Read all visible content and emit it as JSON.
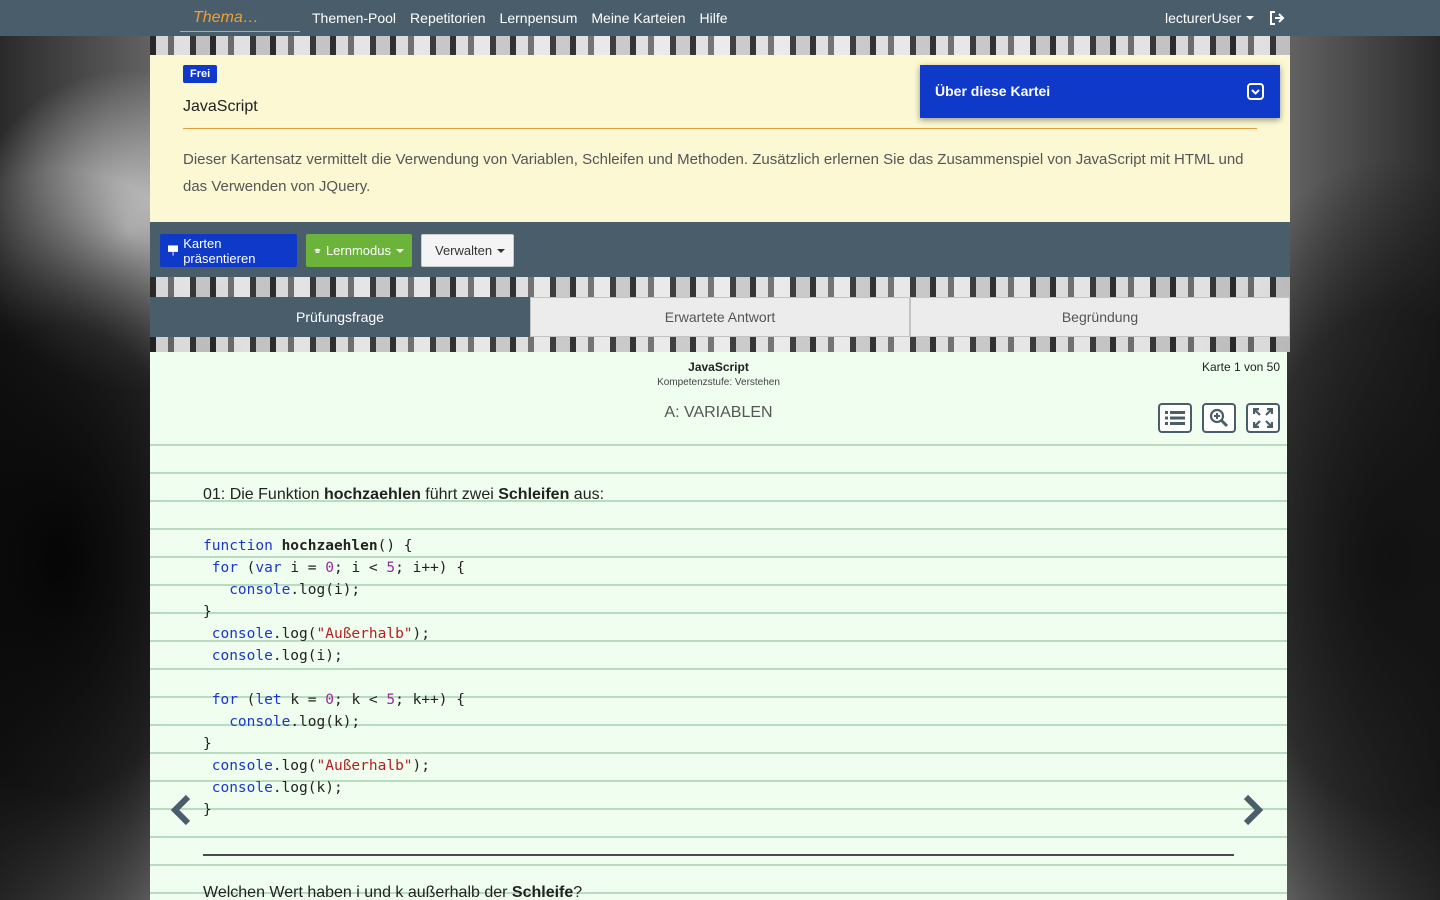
{
  "nav": {
    "brand": "Thema…",
    "links": [
      "Themen-Pool",
      "Repetitorien",
      "Lernpensum",
      "Meine Karteien",
      "Hilfe"
    ],
    "user": "lecturerUser",
    "logout_icon": "logout-icon"
  },
  "deck": {
    "badge": "Frei",
    "title": "JavaScript",
    "description": "Dieser Kartensatz vermittelt die Verwendung von Variablen, Schleifen und Methoden. Zusätzlich erlernen Sie das Zusammenspiel von JavaScript mit HTML und das Verwenden von JQuery.",
    "about_label": "Über diese Kartei"
  },
  "toolbar": {
    "present_label": "Karten präsentieren",
    "learn_label": "Lernmodus",
    "manage_label": "Verwalten"
  },
  "tabs": [
    "Prüfungsfrage",
    "Erwartete Antwort",
    "Begründung"
  ],
  "card": {
    "deck_name": "JavaScript",
    "level": "Kompetenzstufe: Verstehen",
    "counter": "Karte 1 von 50",
    "topic": "A: VARIABLEN",
    "intro_prefix": "01: Die Funktion ",
    "intro_func": "hochzaehlen",
    "intro_mid": " führt zwei ",
    "intro_loops": "Schleifen",
    "intro_suffix": " aus:",
    "code": {
      "kw_function": "function",
      "func_name": "hochzaehlen",
      "sig_rest": "() {",
      "kw_for": "for",
      "kw_var": "var",
      "kw_let": "let",
      "zero": "0",
      "five": "5",
      "console": "console",
      "log": ".log",
      "str_outside": "\"Außerhalb\""
    },
    "final_prefix": "Welchen Wert haben i und k außerhalb der ",
    "final_bold": "Schleife",
    "final_suffix": "?"
  },
  "colors": {
    "navbar": "#4a5d6b",
    "brand_accent": "#f0a030",
    "primary_blue": "#0f39c9",
    "learn_green": "#6bb33a",
    "info_bg": "#fbf8d3",
    "card_bg": "#effeef"
  }
}
